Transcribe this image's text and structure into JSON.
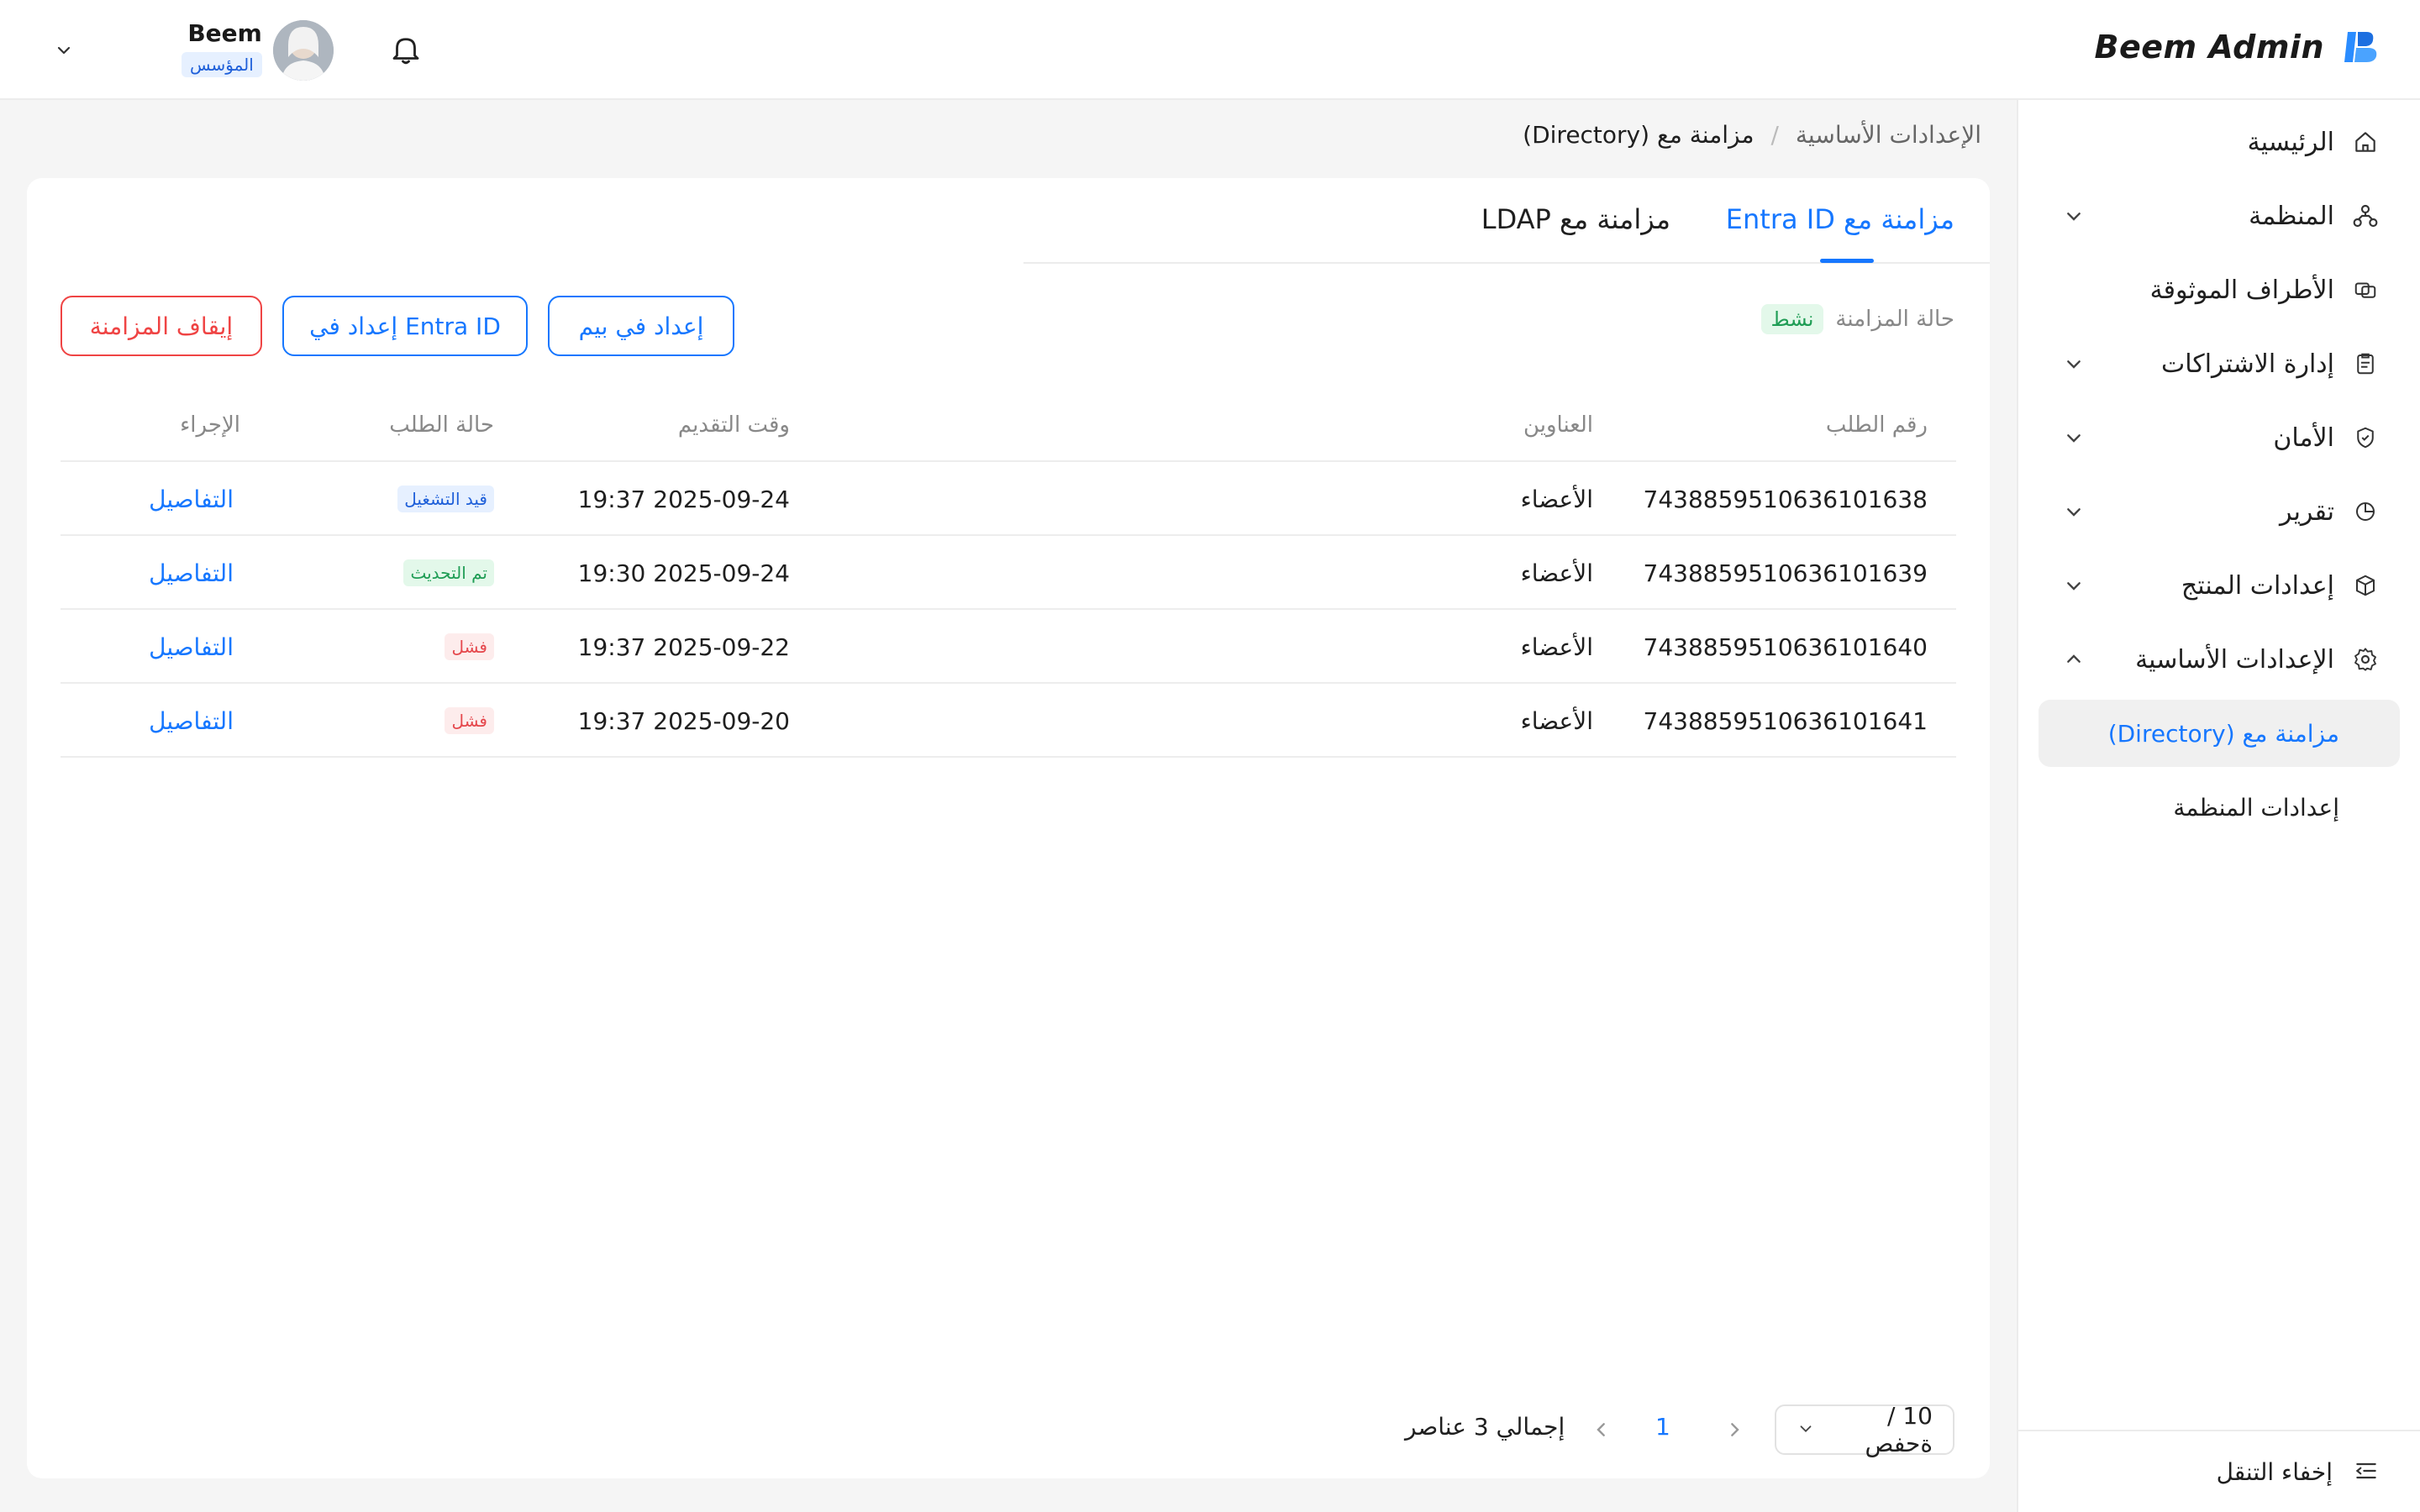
{
  "header": {
    "brand_name": "Beem Admin",
    "user_name": "Beem",
    "user_role": "المؤسس"
  },
  "sidebar": {
    "items": [
      {
        "label": "الرئيسية",
        "icon": "home-icon"
      },
      {
        "label": "المنظمة",
        "icon": "org-icon"
      },
      {
        "label": "الأطراف الموثوقة",
        "icon": "trusted-parties-icon"
      },
      {
        "label": "إدارة الاشتراكات",
        "icon": "clipboard-icon"
      },
      {
        "label": "الأمان",
        "icon": "shield-icon"
      },
      {
        "label": "تقرير",
        "icon": "pie-chart-icon"
      },
      {
        "label": "إعدادات المنتج",
        "icon": "box-icon"
      },
      {
        "label": "الإعدادات الأساسية",
        "icon": "gear-icon"
      }
    ],
    "sub_items": [
      {
        "label": "مزامنة مع (Directory)",
        "active": true
      },
      {
        "label": "إعدادات المنظمة",
        "active": false
      }
    ],
    "footer_label": "إخفاء التنقل"
  },
  "breadcrumb": {
    "parent": "الإعدادات الأساسية",
    "separator": "/",
    "current": "مزامنة مع (Directory)"
  },
  "tabs": [
    {
      "label": "مزامنة مع Entra ID",
      "active": true
    },
    {
      "label": "مزامنة مع LDAP",
      "active": false
    }
  ],
  "sync_status": {
    "label": "حالة المزامنة",
    "value": "نشط"
  },
  "buttons": {
    "setup_beem": "إعداد في بيم",
    "setup_entra": "إعداد في Entra ID",
    "stop_sync": "إيقاف المزامنة"
  },
  "table": {
    "columns": {
      "request_id": "رقم الطلب",
      "addresses": "العناوين",
      "submit_time": "وقت التقديم",
      "request_status": "حالة الطلب",
      "action": "الإجراء"
    },
    "rows": [
      {
        "id": "7438859510636101638",
        "address": "الأعضاء",
        "time": "2025-09-24 19:37",
        "status": "قيد التشغيل",
        "status_type": "blue",
        "action": "التفاصيل"
      },
      {
        "id": "7438859510636101639",
        "address": "الأعضاء",
        "time": "2025-09-24 19:30",
        "status": "تم التحديث",
        "status_type": "green",
        "action": "التفاصيل"
      },
      {
        "id": "7438859510636101640",
        "address": "الأعضاء",
        "time": "2025-09-22 19:37",
        "status": "فشل",
        "status_type": "red",
        "action": "التفاصيل"
      },
      {
        "id": "7438859510636101641",
        "address": "الأعضاء",
        "time": "2025-09-20 19:37",
        "status": "فشل",
        "status_type": "red",
        "action": "التفاصيل"
      }
    ]
  },
  "pagination": {
    "page_size": "10 / ةحفص",
    "current_page": "1",
    "total": "إجمالي 3 عناصر"
  },
  "colors": {
    "accent": "#1677ff",
    "danger": "#ef4444",
    "success": "#1f9d55"
  }
}
